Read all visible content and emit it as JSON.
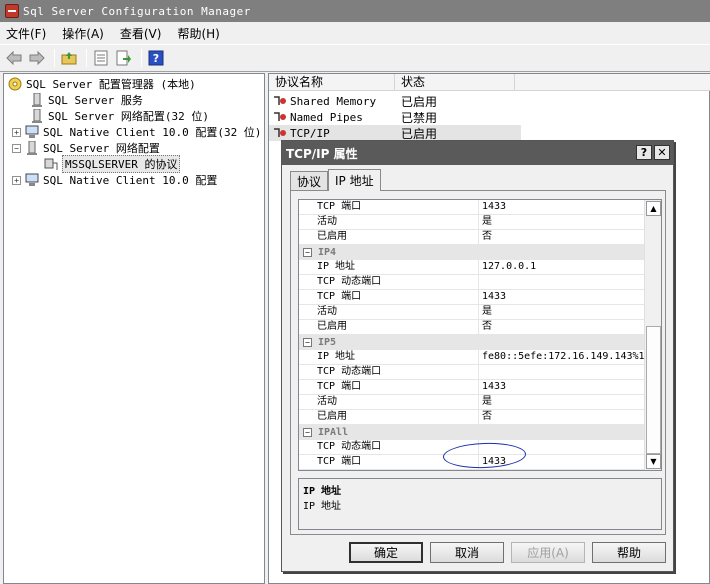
{
  "window": {
    "title": "Sql Server Configuration Manager"
  },
  "menubar": {
    "items": [
      "文件(F)",
      "操作(A)",
      "查看(V)",
      "帮助(H)"
    ]
  },
  "toolbar": {
    "buttons": [
      "back-arrow-icon",
      "forward-arrow-icon",
      "up-folder-icon",
      "properties-icon",
      "export-icon",
      "help-icon"
    ]
  },
  "tree": {
    "items": [
      {
        "label": "SQL Server 配置管理器 (本地)"
      },
      {
        "label": "SQL Server 服务"
      },
      {
        "label": "SQL Server 网络配置(32 位)"
      },
      {
        "label": "SQL Native Client 10.0 配置(32 位)"
      },
      {
        "label": "SQL Server 网络配置"
      },
      {
        "label": "MSSQLSERVER 的协议",
        "selected": true
      },
      {
        "label": "SQL Native Client 10.0 配置"
      }
    ]
  },
  "list": {
    "headers": [
      "协议名称",
      "状态"
    ],
    "rows": [
      {
        "name": "Shared Memory",
        "status": "已启用"
      },
      {
        "name": "Named Pipes",
        "status": "已禁用"
      },
      {
        "name": "TCP/IP",
        "status": "已启用"
      }
    ]
  },
  "dialog": {
    "title": "TCP/IP 属性",
    "help_btn": "?",
    "close_btn": "✕",
    "tabs": [
      "协议",
      "IP 地址"
    ],
    "active_tab": 1,
    "grid": {
      "rows": [
        {
          "key": "TCP 端口",
          "value": "1433"
        },
        {
          "key": "活动",
          "value": "是"
        },
        {
          "key": "已启用",
          "value": "否"
        },
        {
          "category": "IP4"
        },
        {
          "key": "IP 地址",
          "value": "127.0.0.1"
        },
        {
          "key": "TCP 动态端口",
          "value": ""
        },
        {
          "key": "TCP 端口",
          "value": "1433"
        },
        {
          "key": "活动",
          "value": "是"
        },
        {
          "key": "已启用",
          "value": "否"
        },
        {
          "category": "IP5"
        },
        {
          "key": "IP 地址",
          "value": "fe80::5efe:172.16.149.143%1"
        },
        {
          "key": "TCP 动态端口",
          "value": ""
        },
        {
          "key": "TCP 端口",
          "value": "1433"
        },
        {
          "key": "活动",
          "value": "是"
        },
        {
          "key": "已启用",
          "value": "否"
        },
        {
          "category": "IPAll"
        },
        {
          "key": "TCP 动态端口",
          "value": ""
        },
        {
          "key": "TCP 端口",
          "value": "1433"
        }
      ]
    },
    "description": {
      "title": "IP 地址",
      "text": "IP 地址"
    },
    "buttons": {
      "ok": "确定",
      "cancel": "取消",
      "apply": "应用(A)",
      "help": "帮助"
    }
  },
  "colors": {
    "annotation_circle": "#1a2fb0"
  }
}
